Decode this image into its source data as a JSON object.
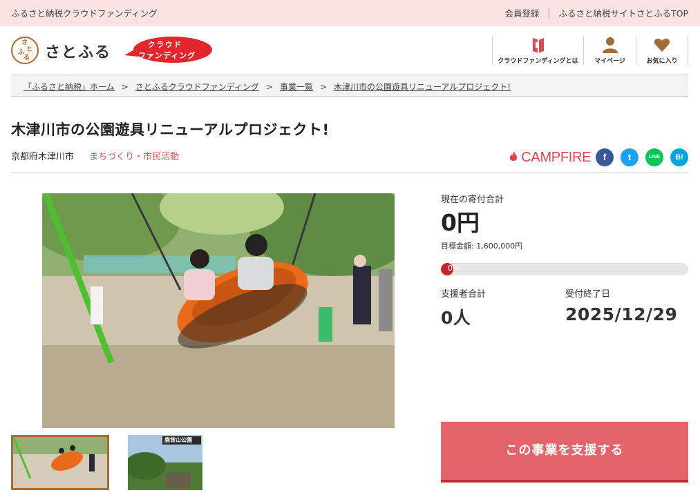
{
  "topbar": {
    "site_tag": "ふるさと納税クラウドファンディング",
    "member_register": "会員登録",
    "satofull_top": "ふるさと納税サイトさとふるTOP"
  },
  "header": {
    "logo_text": "さとふる",
    "logo_mark_chars": [
      "さ",
      "と",
      "ふ",
      "る"
    ],
    "badge_line1": "クラウド",
    "badge_line2": "ファンディング",
    "nav": [
      {
        "label": "クラウドファンディングとは",
        "icon": "book-icon"
      },
      {
        "label": "マイページ",
        "icon": "user-icon"
      },
      {
        "label": "お気に入り",
        "icon": "heart-icon"
      }
    ]
  },
  "breadcrumb": [
    "「ふるさと納税」ホーム",
    "さとふるクラウドファンディング",
    "事業一覧",
    "木津川市の公園遊具リニューアルプロジェクト!"
  ],
  "breadcrumb_separator": ">",
  "project": {
    "title": "木津川市の公園遊具リニューアルプロジェクト!",
    "location": "京都府木津川市",
    "category": "まちづくり・市民活動",
    "partner": "CAMPFIRE"
  },
  "social": {
    "facebook": "f",
    "twitter": "t",
    "line": "LINE",
    "hatena": "B!"
  },
  "stats": {
    "total_label": "現在の寄付合計",
    "total_amount": "0円",
    "goal_text": "目標金額: 1,600,000円",
    "progress_text": "0%",
    "progress_value": 0,
    "supporters_label": "支援者合計",
    "supporters_value": "0人",
    "deadline_label": "受付終了日",
    "deadline_value": "2025/12/29"
  },
  "support_button": "この事業を支援する",
  "thumb2_caption": "鹿背山公園",
  "colors": {
    "accent": "#e3656b",
    "accent_dark": "#c1282e",
    "brand_brown": "#a46b3a",
    "topbar_bg": "#fbe3e3"
  }
}
